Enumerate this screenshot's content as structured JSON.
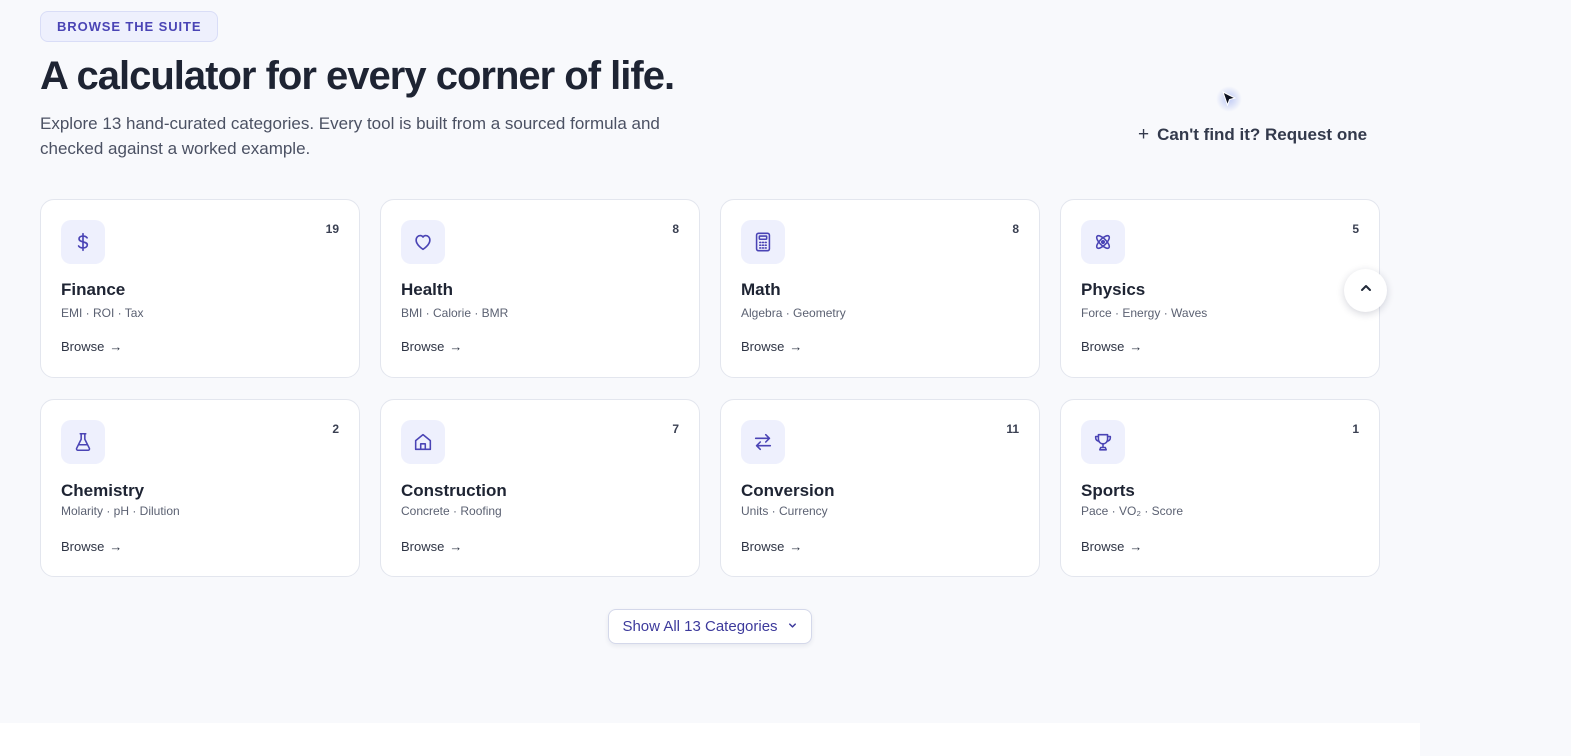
{
  "header": {
    "eyebrow": "BROWSE THE SUITE",
    "title": "A calculator for every corner of life.",
    "subtitle": "Explore 13 hand-curated categories. Every tool is built from a sourced formula and checked against a worked example.",
    "request_label": "Can't find it? Request one",
    "request_icon": "plus-icon"
  },
  "accent_color": "#4a44b5",
  "categories": [
    {
      "name": "Finance",
      "tags": "EMI · ROI · Tax",
      "count": "19",
      "browse": "Browse",
      "icon": "dollar-icon"
    },
    {
      "name": "Health",
      "tags": "BMI · Calorie · BMR",
      "count": "8",
      "browse": "Browse",
      "icon": "heart-icon"
    },
    {
      "name": "Math",
      "tags": "Algebra · Geometry",
      "count": "8",
      "browse": "Browse",
      "icon": "calculator-icon"
    },
    {
      "name": "Physics",
      "tags": "Force · Energy · Waves",
      "count": "5",
      "browse": "Browse",
      "icon": "atom-icon"
    },
    {
      "name": "Chemistry",
      "tags": "Molarity · pH · Dilution",
      "count": "2",
      "browse": "Browse",
      "icon": "flask-icon"
    },
    {
      "name": "Construction",
      "tags": "Concrete · Roofing",
      "count": "7",
      "browse": "Browse",
      "icon": "house-icon"
    },
    {
      "name": "Conversion",
      "tags": "Units · Currency",
      "count": "11",
      "browse": "Browse",
      "icon": "arrows-swap-icon"
    },
    {
      "name": "Sports",
      "tags": "Pace · VO₂ · Score",
      "count": "1",
      "browse": "Browse",
      "icon": "trophy-icon"
    }
  ],
  "show_all_label": "Show All 13 Categories",
  "scroll_top_icon": "chevron-up-icon"
}
